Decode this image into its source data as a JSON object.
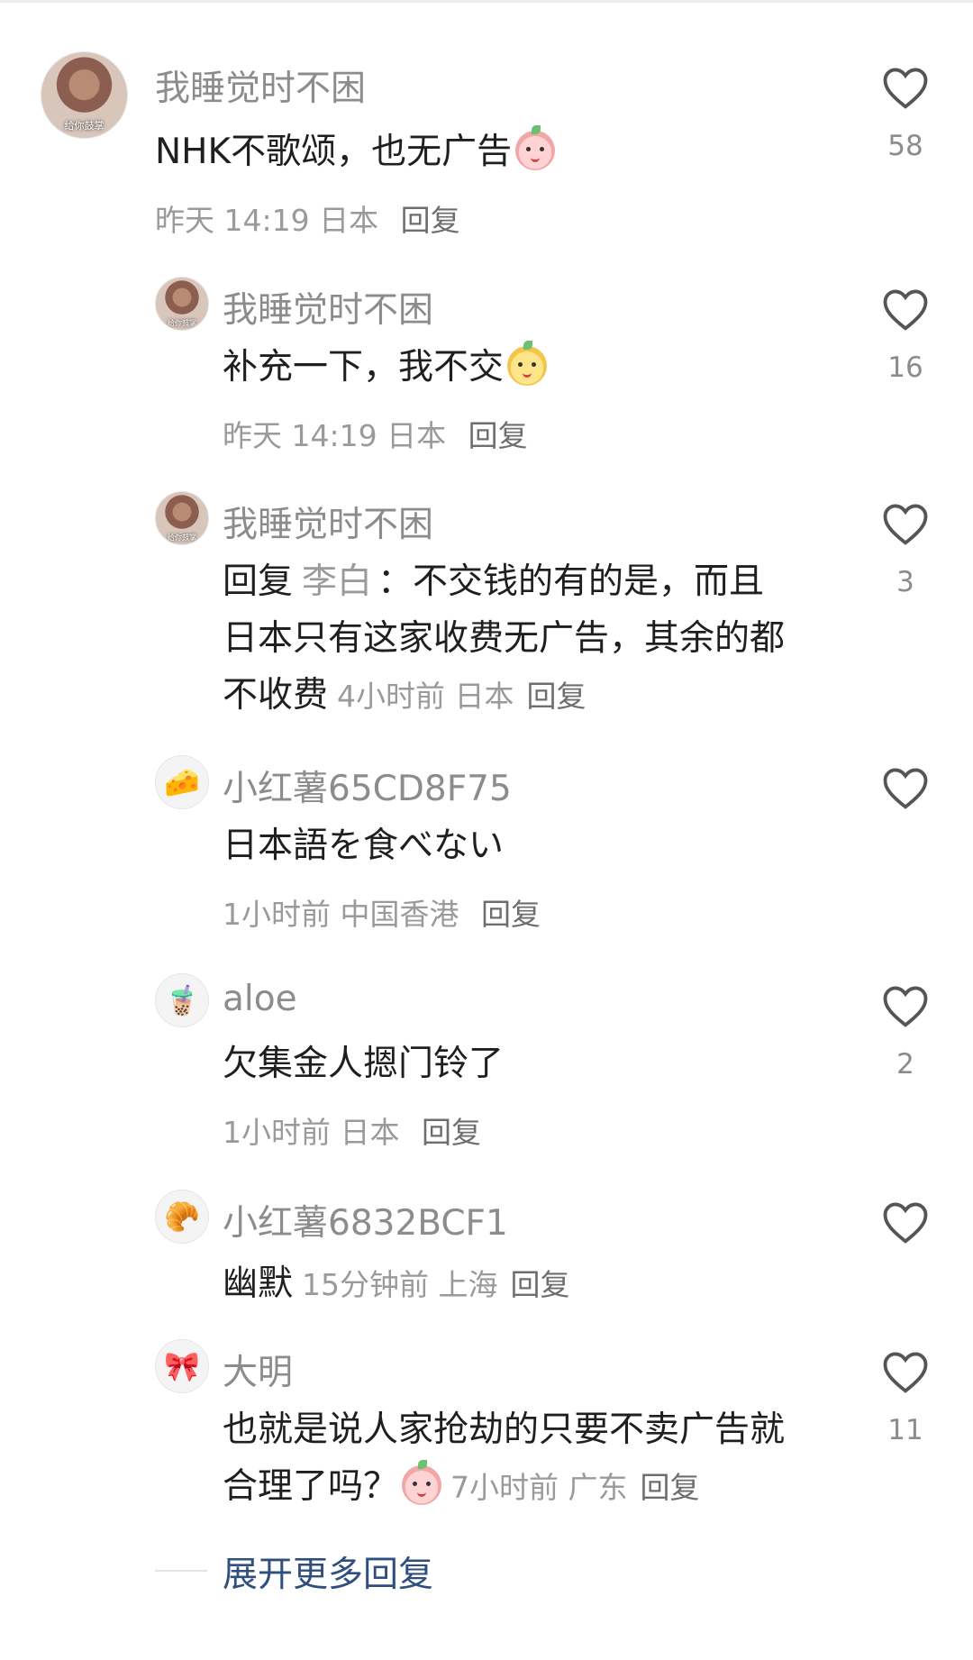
{
  "comments": [
    {
      "username": "我睡觉时不困",
      "avatar_caption": "给你鼓掌",
      "text": "NHK不歌颂，也无广告",
      "emoji": "peach-face-emoji",
      "time": "昨天 14:19",
      "location": "日本",
      "reply_label": "回复",
      "likes": "58"
    },
    {
      "username": "我睡觉时不困",
      "avatar_caption": "给你鼓掌",
      "text": "补充一下，我不交",
      "emoji": "dog-face-emoji",
      "time": "昨天 14:19",
      "location": "日本",
      "reply_label": "回复",
      "likes": "16"
    },
    {
      "username": "我睡觉时不困",
      "avatar_caption": "给你鼓掌",
      "reply_prefix": "回复",
      "reply_to": "李白",
      "text_line1": "：不交钱的有的是，而且",
      "text_line2": "日本只有这家收费无广告，其余的都",
      "text_line3": "不收费",
      "time": "4小时前",
      "location": "日本",
      "reply_label": "回复",
      "likes": "3"
    },
    {
      "username": "小红薯65CD8F75",
      "avatar_icon": "cheese-icon",
      "text": "日本語を食べない",
      "time": "1小时前",
      "location": "中国香港",
      "reply_label": "回复",
      "likes": ""
    },
    {
      "username": "aloe",
      "avatar_icon": "bubble-tea-icon",
      "text": "欠集金人摁门铃了",
      "time": "1小时前",
      "location": "日本",
      "reply_label": "回复",
      "likes": "2"
    },
    {
      "username": "小红薯6832BCF1",
      "avatar_icon": "croissant-icon",
      "text": "幽默",
      "time": "15分钟前",
      "location": "上海",
      "reply_label": "回复",
      "likes": ""
    },
    {
      "username": "大明",
      "avatar_icon": "bow-icon",
      "text_line1": "也就是说人家抢劫的只要不卖广告就",
      "text_line2": "合理了吗？",
      "emoji": "peach-face-emoji",
      "time": "7小时前",
      "location": "广东",
      "reply_label": "回复",
      "likes": "11"
    }
  ],
  "expand_more": "展开更多回复",
  "colors": {
    "username": "#8c8c8c",
    "text": "#1f1f1f",
    "meta": "#9a9a9a",
    "expand": "#2f4f7f"
  }
}
